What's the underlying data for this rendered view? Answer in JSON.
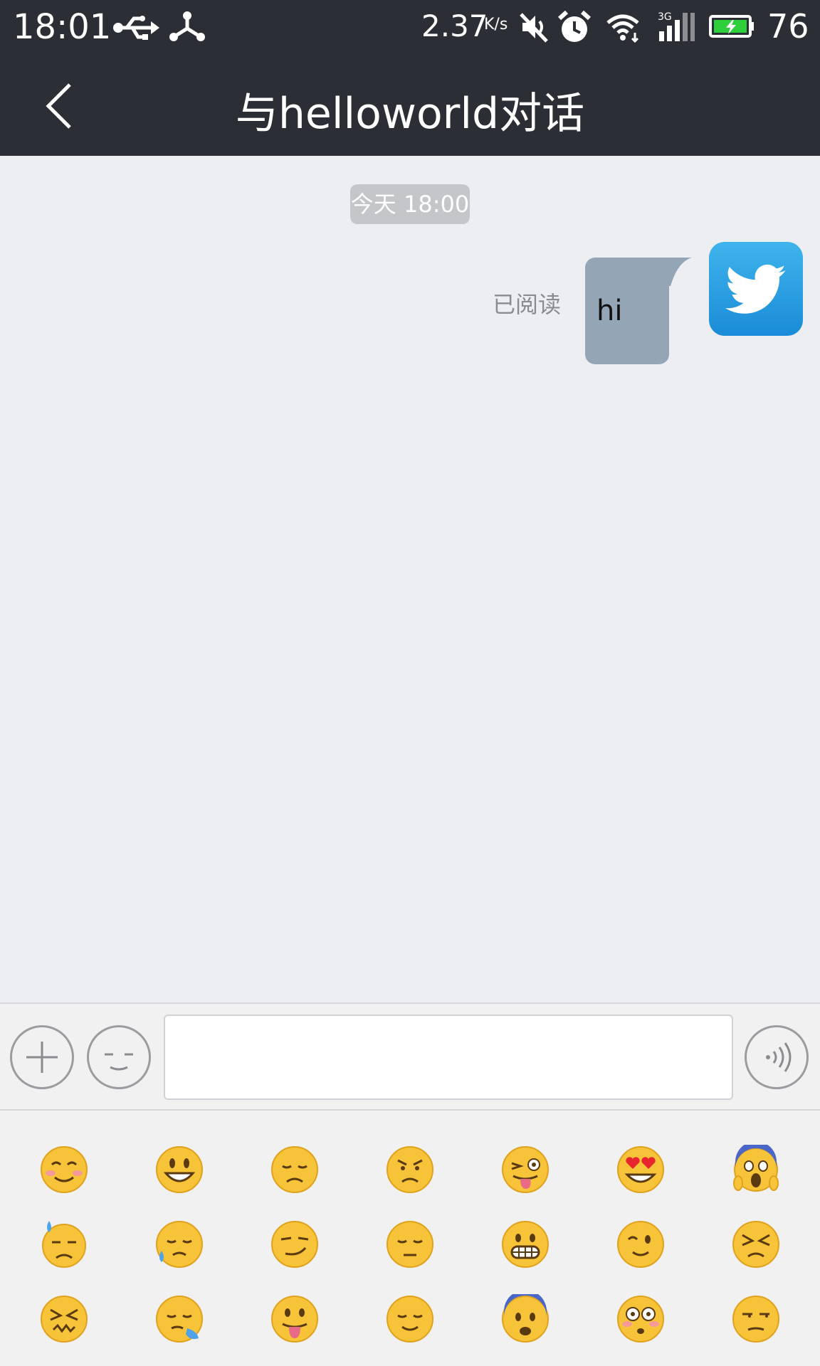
{
  "status_bar": {
    "time": "18:01",
    "speed": "2.37",
    "speed_unit": "K/s",
    "network": "3G",
    "battery_level": "76",
    "icons": [
      "usb-icon",
      "share-icon",
      "mute-icon",
      "alarm-icon",
      "wifi-icon",
      "signal-icon",
      "battery-icon"
    ]
  },
  "header": {
    "title": "与helloworld对话",
    "back_icon": "chevron-left-icon"
  },
  "chat": {
    "timestamp": "今天 18:00",
    "messages": [
      {
        "text": "hi",
        "status": "已阅读",
        "sender": "me",
        "avatar": "twitter-bird"
      }
    ]
  },
  "input_bar": {
    "value": "",
    "placeholder": "",
    "buttons": [
      "plus-icon",
      "emoji-icon",
      "voice-icon"
    ]
  },
  "emoji_panel": {
    "emojis": [
      "blush",
      "smiley",
      "disappointed",
      "angry",
      "stuck-out-tongue-winking-eye",
      "heart-eyes",
      "scream",
      "cold-sweat",
      "disappointed-relieved",
      "smirk",
      "pensive",
      "grimacing",
      "wink",
      "persevere",
      "confounded",
      "sleepy",
      "stuck-out-tongue",
      "relieved",
      "fearful",
      "flushed",
      "unamused"
    ]
  },
  "colors": {
    "bar_bg": "#2b2f35",
    "chat_bg": "#eceef2",
    "bubble": "#94a6b6",
    "emoji_face": "#f7c339"
  }
}
